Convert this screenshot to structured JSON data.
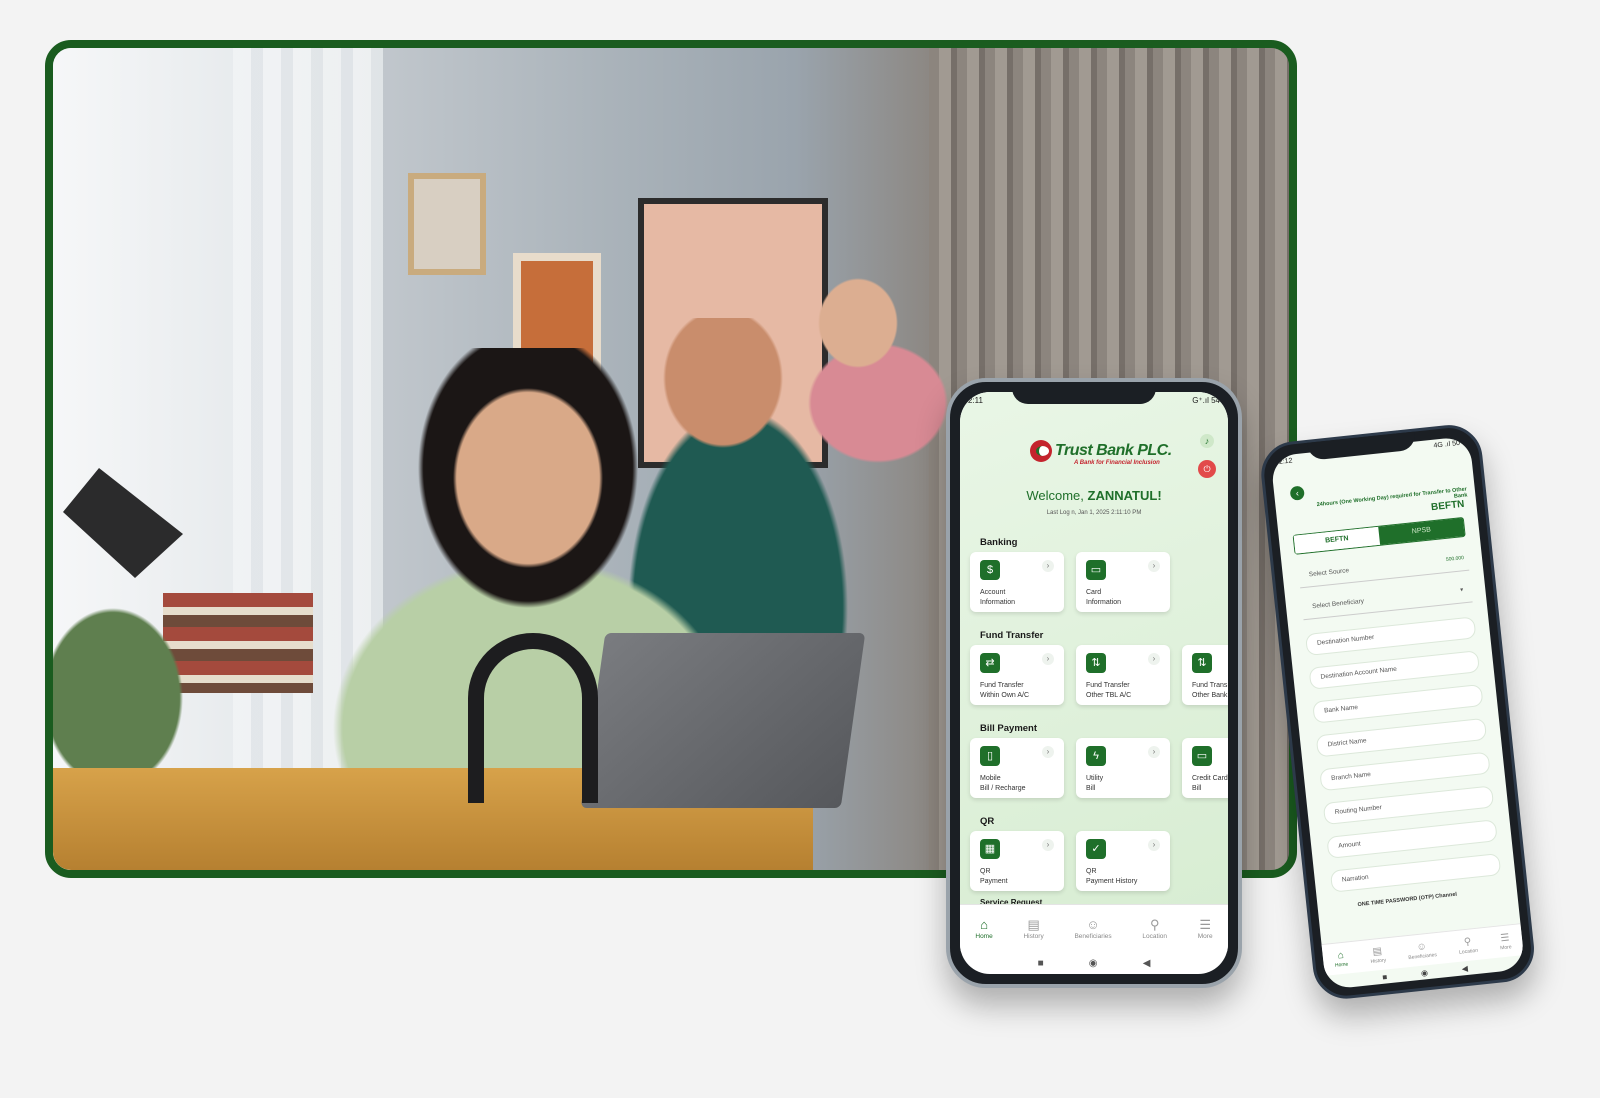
{
  "phone_main": {
    "status_time": "2:11",
    "status_icons": "G⁺.ıl 54",
    "logo_name": "Trust Bank PLC.",
    "logo_tagline": "A Bank for Financial Inclusion",
    "welcome_prefix": "Welcome,",
    "welcome_name": "ZANNATUL!",
    "last_login": "Last Log n, Jan 1, 2025 2:11:10 PM",
    "sections": {
      "banking": "Banking",
      "fund_transfer": "Fund Transfer",
      "bill_payment": "Bill Payment",
      "qr": "QR",
      "service_request": "Service Request"
    },
    "cards": {
      "account_info": "Account\nInformation",
      "card_info": "Card\nInformation",
      "ft_own": "Fund Transfer\nWithin Own A/C",
      "ft_tbl": "Fund Transfer\nOther TBL A/C",
      "ft_other_bank": "Fund Trans\nOther Bank",
      "mobile_bill": "Mobile\nBill / Recharge",
      "utility_bill": "Utility\nBill",
      "credit_card_bill": "Credit Card\nBill",
      "qr_payment": "QR\nPayment",
      "qr_history": "QR\nPayment History"
    },
    "tabs": [
      "Home",
      "History",
      "Beneficiaries",
      "Location",
      "More"
    ],
    "icons": {
      "bell": "bell-icon",
      "logout": "logout-icon"
    }
  },
  "phone_befn": {
    "status_time": "2:12",
    "status_icons": "4G .ıl 50",
    "title": "BEFTN",
    "note": "24hours (One Working Day) required for Transfer to Other Bank",
    "segments": [
      "BEFTN",
      "NPSB"
    ],
    "select_source": "Select Source",
    "select_source_balance": "500.000",
    "select_beneficiary": "Select Beneficiary",
    "fields": [
      "Destination Number",
      "Destination Account Name",
      "Bank Name",
      "District Name",
      "Branch Name",
      "Routing Number",
      "Amount",
      "Narration"
    ],
    "otp_label": "ONE TIME PASSWORD (OTP) Channel",
    "tabs": [
      "Home",
      "History",
      "Beneficiaries",
      "Location",
      "More"
    ]
  },
  "colors": {
    "brand_green": "#1f6f2a",
    "brand_red": "#c4232d",
    "frame_green": "#1a5c1f"
  }
}
